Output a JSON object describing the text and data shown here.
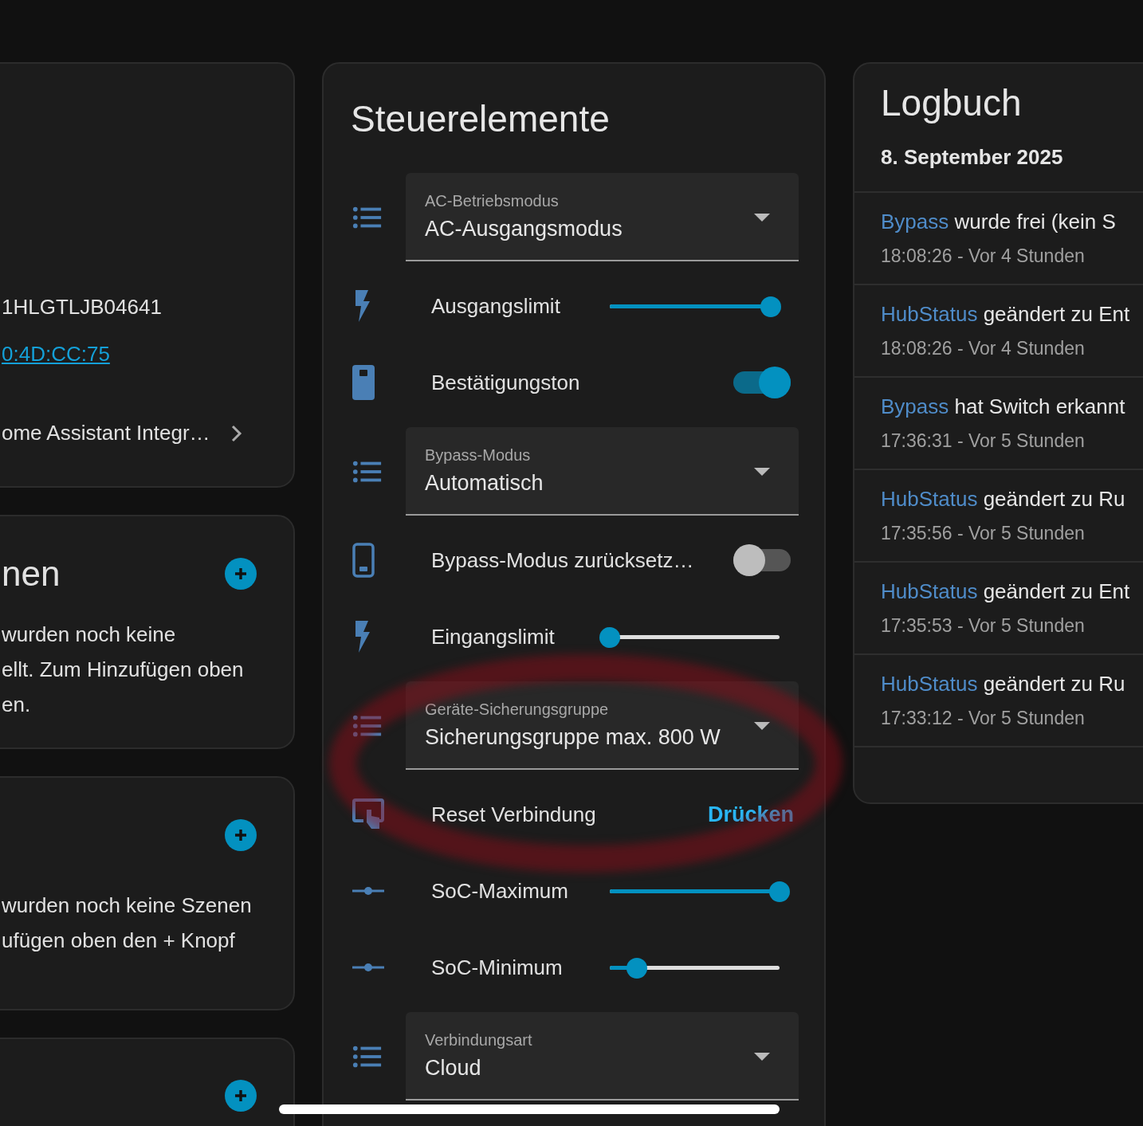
{
  "device_card": {
    "serial": "1HLGTLJB04641",
    "mac_link": "0:4D:CC:75",
    "integration_link": "ome Assistant Integr…"
  },
  "automations_card": {
    "title": "nen",
    "text_lines": [
      "wurden noch keine",
      "ellt. Zum Hinzufügen oben",
      "en."
    ]
  },
  "scenes_card": {
    "text_lines": [
      "wurden noch keine Szenen",
      "ufügen oben den + Knopf"
    ]
  },
  "controls": {
    "title": "Steuerelemente",
    "rows": [
      {
        "kind": "select",
        "label": "AC-Betriebsmodus",
        "value": "AC-Ausgangsmodus"
      },
      {
        "kind": "slider",
        "label": "Ausgangslimit",
        "level": 0.95
      },
      {
        "kind": "toggle",
        "label": "Bestätigungston",
        "on": true
      },
      {
        "kind": "select",
        "label": "Bypass-Modus",
        "value": "Automatisch"
      },
      {
        "kind": "toggle",
        "label": "Bypass-Modus zurücksetz…",
        "on": false
      },
      {
        "kind": "slider",
        "label": "Eingangslimit",
        "level": 0.0
      },
      {
        "kind": "select",
        "label": "Geräte-Sicherungsgruppe",
        "value": "Sicherungsgruppe max. 800 W"
      },
      {
        "kind": "button",
        "label": "Reset Verbindung",
        "action": "Drücken"
      },
      {
        "kind": "slider",
        "label": "SoC-Maximum",
        "level": 1.0
      },
      {
        "kind": "slider",
        "label": "SoC-Minimum",
        "level": 0.16
      },
      {
        "kind": "select",
        "label": "Verbindungsart",
        "value": "Cloud"
      }
    ]
  },
  "logbook": {
    "title": "Logbuch",
    "date": "8. September 2025",
    "entries": [
      {
        "entity": "Bypass",
        "message": "wurde frei (kein S",
        "time": "18:08:26 - Vor 4 Stunden"
      },
      {
        "entity": "HubStatus",
        "message": "geändert zu Ent",
        "time": "18:08:26 - Vor 4 Stunden"
      },
      {
        "entity": "Bypass",
        "message": "hat Switch erkannt",
        "time": "17:36:31 - Vor 5 Stunden"
      },
      {
        "entity": "HubStatus",
        "message": "geändert zu Ru",
        "time": "17:35:56 - Vor 5 Stunden"
      },
      {
        "entity": "HubStatus",
        "message": "geändert zu Ent",
        "time": "17:35:53 - Vor 5 Stunden"
      },
      {
        "entity": "HubStatus",
        "message": "geändert zu Ru",
        "time": "17:33:12 - Vor 5 Stunden"
      }
    ]
  }
}
